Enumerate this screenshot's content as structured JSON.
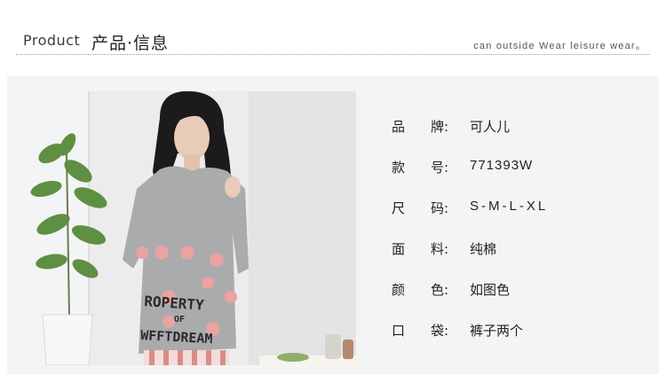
{
  "header": {
    "title_en": "Product",
    "title_cn": "产品·信息",
    "slogan": "can outside Wear leisure wear。"
  },
  "photo": {
    "shirt_print": [
      "ROPERTY",
      "OF",
      "WFFTDREAM"
    ]
  },
  "specs": [
    {
      "key_1": "品",
      "key_2": "牌:",
      "value": "可人儿"
    },
    {
      "key_1": "款",
      "key_2": "号:",
      "value": "771393W"
    },
    {
      "key_1": "尺",
      "key_2": "码:",
      "value": "S-M-L-XL"
    },
    {
      "key_1": "面",
      "key_2": "料:",
      "value": "纯棉"
    },
    {
      "key_1": "颜",
      "key_2": "色:",
      "value": "如图色"
    },
    {
      "key_1": "口",
      "key_2": "袋:",
      "value": "裤子两个"
    }
  ],
  "colors": {
    "panel_bg": "#f4f4f4",
    "shirt_gray": "#a9abad",
    "polka_pink": "#e9a3a0",
    "text": "#222222"
  }
}
